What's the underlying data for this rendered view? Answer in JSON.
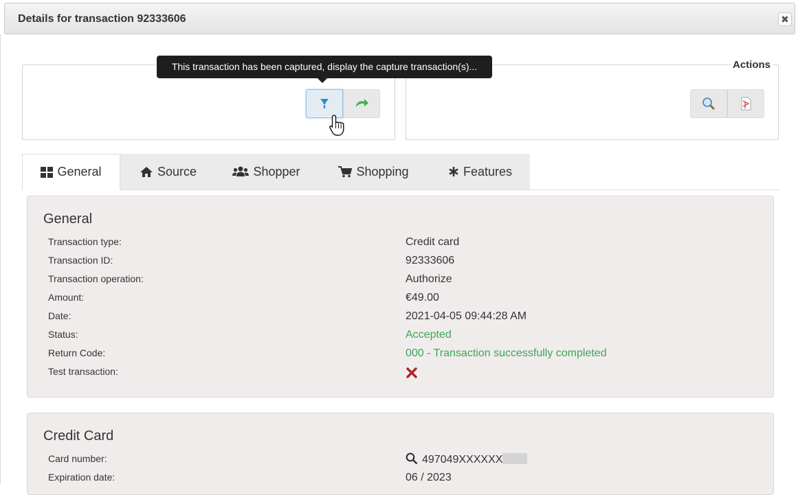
{
  "dialog": {
    "title": "Details for transaction 92333606",
    "close_label": "✖"
  },
  "tooltip": {
    "text": "This transaction has been captured, display the capture transaction(s)..."
  },
  "actions": {
    "legend": "Actions"
  },
  "tabs": [
    {
      "label": "General",
      "icon": "grid-icon"
    },
    {
      "label": "Source",
      "icon": "home-icon"
    },
    {
      "label": "Shopper",
      "icon": "users-icon"
    },
    {
      "label": "Shopping",
      "icon": "cart-icon"
    },
    {
      "label": "Features",
      "icon": "asterisk-icon"
    }
  ],
  "general": {
    "title": "General",
    "rows": [
      {
        "label": "Transaction type:",
        "value": "Credit card"
      },
      {
        "label": "Transaction ID:",
        "value": "92333606"
      },
      {
        "label": "Transaction operation:",
        "value": "Authorize"
      },
      {
        "label": "Amount:",
        "value": "€49.00"
      },
      {
        "label": "Date:",
        "value": "2021-04-05 09:44:28 AM"
      },
      {
        "label": "Status:",
        "value": "Accepted"
      },
      {
        "label": "Return Code:",
        "value": "000 - Transaction successfully completed"
      },
      {
        "label": "Test transaction:",
        "value": ""
      }
    ]
  },
  "credit_card": {
    "title": "Credit Card",
    "rows": [
      {
        "label": "Card number:",
        "value": "497049XXXXXX"
      },
      {
        "label": "Expiration date:",
        "value": "06 / 2023"
      }
    ]
  },
  "colors": {
    "success": "#3aa655",
    "panel_bg": "#f1ecec",
    "tooltip_bg": "#1e1e1e"
  }
}
